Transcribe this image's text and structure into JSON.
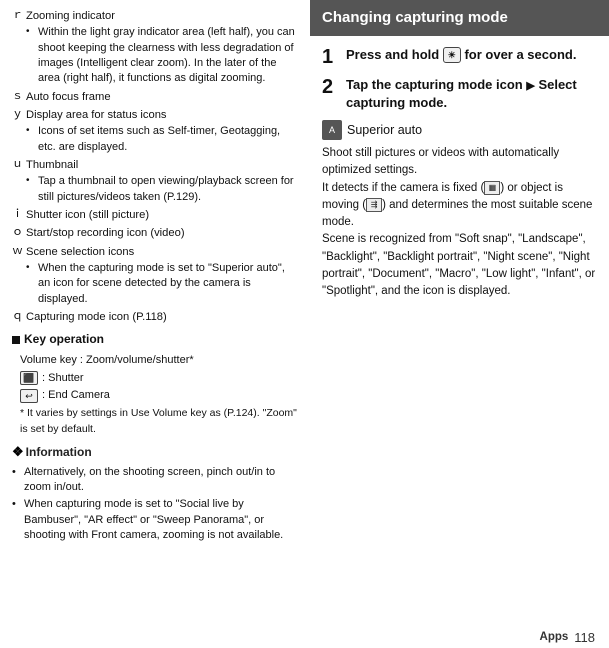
{
  "left": {
    "items": [
      {
        "label": "ｒ",
        "text": "Zooming indicator",
        "sub": [
          "Within the light gray indicator area (left half), you can shoot keeping the clearness with less degradation of images (Intelligent clear zoom). In the later of the area (right half), it functions as digital zooming."
        ]
      },
      {
        "label": "ｓ",
        "text": "Auto focus frame",
        "sub": []
      },
      {
        "label": "ｙ",
        "text": "Display area for status icons",
        "sub": [
          "Icons of set items such as Self-timer, Geotagging, etc. are displayed."
        ]
      },
      {
        "label": "ｕ",
        "text": "Thumbnail",
        "sub": [
          "Tap a thumbnail to open viewing/playback screen for still pictures/videos taken (P.129)."
        ]
      },
      {
        "label": "ｉ",
        "text": "Shutter icon (still picture)",
        "sub": []
      },
      {
        "label": "ｏ",
        "text": "Start/stop recording icon (video)",
        "sub": []
      },
      {
        "label": "ｗ",
        "text": "Scene selection icons",
        "sub": [
          "When the capturing mode is set to \"Superior auto\", an icon for scene detected by the camera is displayed."
        ]
      },
      {
        "label": "ｑ",
        "text": "Capturing mode icon (P.118)",
        "sub": []
      }
    ],
    "key_operation": {
      "title": "Key operation",
      "volume_line": "Volume key : Zoom/volume/shutter*",
      "shutter_label": ": Shutter",
      "end_label": ": End Camera",
      "note": "* It varies by settings in Use Volume key as (P.124). \"Zoom\" is set by default."
    },
    "info": {
      "title": "Information",
      "bullets": [
        "Alternatively, on the shooting screen, pinch out/in to zoom in/out.",
        "When capturing mode is set to \"Social live by Bambuser\", \"AR effect\" or \"Sweep Panorama\", or shooting with Front camera, zooming is not available."
      ]
    }
  },
  "right": {
    "header": "Changing capturing mode",
    "step1_num": "1",
    "step1_text": "Press and hold",
    "step1_suffix": "for over a second.",
    "step2_num": "2",
    "step2_text": "Tap the capturing mode icon",
    "step2_arrow": "▶",
    "step2_suffix": "Select capturing mode.",
    "superior_label": "Superior auto",
    "description": "Shoot still pictures or videos with automatically optimized settings.\nIt detects if the camera is fixed (       ) or object is moving (       ) and determines the most suitable scene mode.\nScene is recognized from \"Soft snap\", \"Landscape\", \"Backlight\", \"Backlight portrait\", \"Night scene\", \"Night portrait\", \"Document\", \"Macro\", \"Low light\", \"Infant\", or \"Spotlight\", and the icon is displayed."
  },
  "footer": {
    "apps_label": "Apps",
    "page_num": "118"
  }
}
